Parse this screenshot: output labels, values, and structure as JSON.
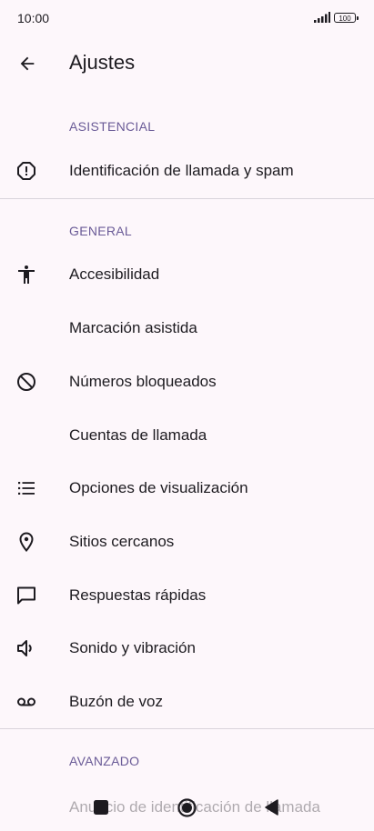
{
  "status": {
    "time": "10:00",
    "battery": "100"
  },
  "header": {
    "title": "Ajustes"
  },
  "sections": {
    "asistencial": "ASISTENCIAL",
    "general": "GENERAL",
    "avanzado": "AVANZADO"
  },
  "items": {
    "caller_id": {
      "label": "Identificación de llamada y spam",
      "icon": "alert-octagon-icon"
    },
    "accessibility": {
      "label": "Accesibilidad",
      "icon": "accessibility-icon"
    },
    "assisted_dialing": {
      "label": "Marcación asistida"
    },
    "blocked_numbers": {
      "label": "Números bloqueados",
      "icon": "block-icon"
    },
    "calling_accounts": {
      "label": "Cuentas de llamada"
    },
    "display_options": {
      "label": "Opciones de visualización",
      "icon": "list-icon"
    },
    "nearby_places": {
      "label": "Sitios cercanos",
      "icon": "location-pin-icon"
    },
    "quick_responses": {
      "label": "Respuestas rápidas",
      "icon": "message-icon"
    },
    "sound_vibration": {
      "label": "Sonido y vibración",
      "icon": "volume-icon"
    },
    "voicemail": {
      "label": "Buzón de voz",
      "icon": "voicemail-icon"
    },
    "caller_id_announcement": {
      "label": "Anuncio de identificación de llamada"
    }
  },
  "colors": {
    "background": "#fdf7fb",
    "section_header": "#6a5b97",
    "text": "#1d1b20",
    "divider": "#d9d4dc"
  }
}
